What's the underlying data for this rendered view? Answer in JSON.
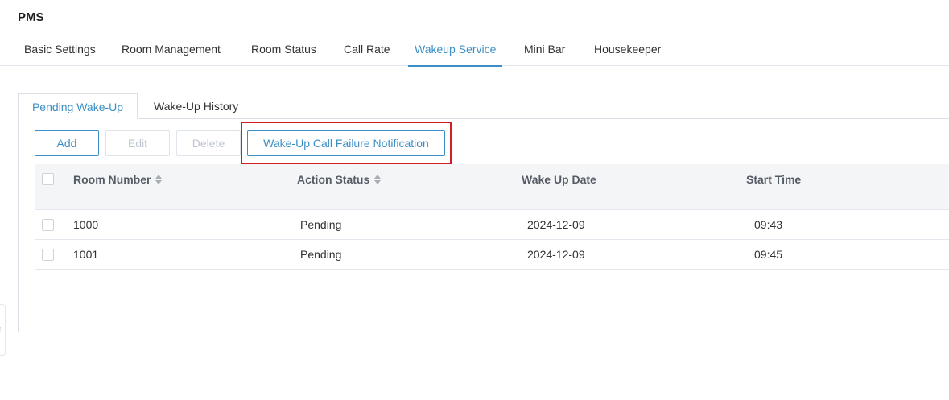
{
  "app": {
    "title": "PMS"
  },
  "nav": {
    "items": [
      {
        "label": "Basic Settings"
      },
      {
        "label": "Room Management"
      },
      {
        "label": "Room Status"
      },
      {
        "label": "Call Rate"
      },
      {
        "label": "Wakeup Service",
        "active": true
      },
      {
        "label": "Mini Bar"
      },
      {
        "label": "Housekeeper"
      }
    ]
  },
  "subtabs": [
    {
      "label": "Pending Wake-Up",
      "active": true
    },
    {
      "label": "Wake-Up History"
    }
  ],
  "toolbar": {
    "add_label": "Add",
    "edit_label": "Edit",
    "delete_label": "Delete",
    "failure_notification_label": "Wake-Up Call Failure Notification"
  },
  "table": {
    "columns": [
      {
        "label": "Room Number",
        "sortable": true
      },
      {
        "label": "Action Status",
        "sortable": true
      },
      {
        "label": "Wake Up Date"
      },
      {
        "label": "Start Time"
      }
    ],
    "rows": [
      {
        "room": "1000",
        "status": "Pending",
        "date": "2024-12-09",
        "time": "09:43"
      },
      {
        "room": "1001",
        "status": "Pending",
        "date": "2024-12-09",
        "time": "09:45"
      }
    ]
  },
  "colors": {
    "accent": "#3b8fc6",
    "highlight": "#d21f26",
    "header_bg": "#f4f5f7"
  },
  "icons": {
    "sort": "sort-icon",
    "side_handle": "collapse-handle-icon"
  }
}
